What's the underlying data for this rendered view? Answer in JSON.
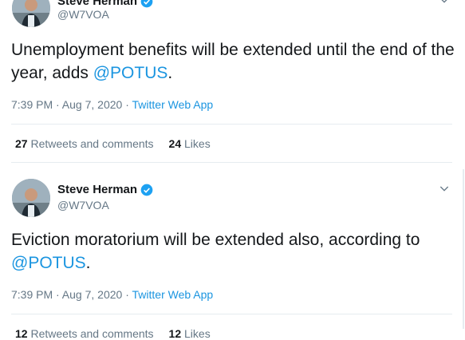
{
  "tweets": [
    {
      "author_name": "Steve Herman",
      "handle": "@W7VOA",
      "text_before": "Unemployment benefits will be extended until the end of the year, adds ",
      "mention": "@POTUS",
      "text_after": ".",
      "time": "7:39 PM · Aug 7, 2020",
      "separator": " · ",
      "app": "Twitter Web App",
      "retweets_count": "27",
      "retweets_label": "Retweets and comments",
      "likes_count": "24",
      "likes_label": "Likes"
    },
    {
      "author_name": "Steve Herman",
      "handle": "@W7VOA",
      "text_before": "Eviction moratorium will be extended also, according to ",
      "mention": "@POTUS",
      "text_after": ".",
      "time": "7:39 PM · Aug 7, 2020",
      "separator": " · ",
      "app": "Twitter Web App",
      "retweets_count": "12",
      "retweets_label": "Retweets and comments",
      "likes_count": "12",
      "likes_label": "Likes"
    }
  ],
  "colors": {
    "link": "#1b95e0",
    "secondary": "#657786",
    "verified": "#1da1f2"
  },
  "icons": [
    "verified-badge-icon",
    "chevron-down-icon"
  ]
}
